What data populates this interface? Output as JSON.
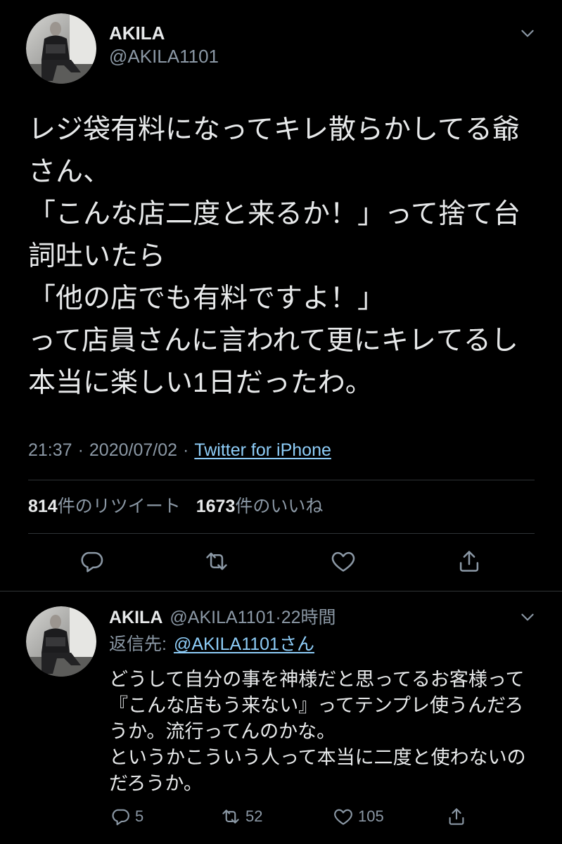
{
  "colors": {
    "background": "#000000",
    "text": "#e7e9ea",
    "secondary": "#8b98a5",
    "link": "#8ecdf8",
    "divider": "#2f3336"
  },
  "icons": {
    "menu": "chevron-down-icon",
    "reply": "reply-icon",
    "retweet": "retweet-icon",
    "like": "heart-icon",
    "share": "share-icon"
  },
  "main_tweet": {
    "author": {
      "name": "AKILA",
      "handle": "@AKILA1101"
    },
    "body_lines": [
      "レジ袋有料になってキレ散らかしてる爺",
      "さん、",
      "「こんな店二度と来るか！」って捨て台",
      "詞吐いたら",
      "「他の店でも有料ですよ！」",
      "って店員さんに言われて更にキレてるし",
      "本当に楽しい1日だったわ。"
    ],
    "meta": {
      "time": "21:37",
      "separator": "·",
      "date": "2020/07/02",
      "source": "Twitter for iPhone"
    },
    "stats": {
      "retweet_count": "814",
      "retweet_label": "件のリツイート",
      "like_count": "1673",
      "like_label": "件のいいね"
    }
  },
  "reply_tweet": {
    "author": {
      "name": "AKILA",
      "handle": "@AKILA1101",
      "separator": "·",
      "time_ago": "22時間"
    },
    "reply_to": {
      "label": "返信先:",
      "mention": "@AKILA1101さん"
    },
    "body_lines": [
      "どうして自分の事を神様だと思ってるお客様って",
      "『こんな店もう来ない』ってテンプレ使うんだろ",
      "うか。流行ってんのかな。",
      "というかこういう人って本当に二度と使わないの",
      "だろうか。"
    ],
    "actions": {
      "reply_count": "5",
      "retweet_count": "52",
      "like_count": "105"
    }
  }
}
